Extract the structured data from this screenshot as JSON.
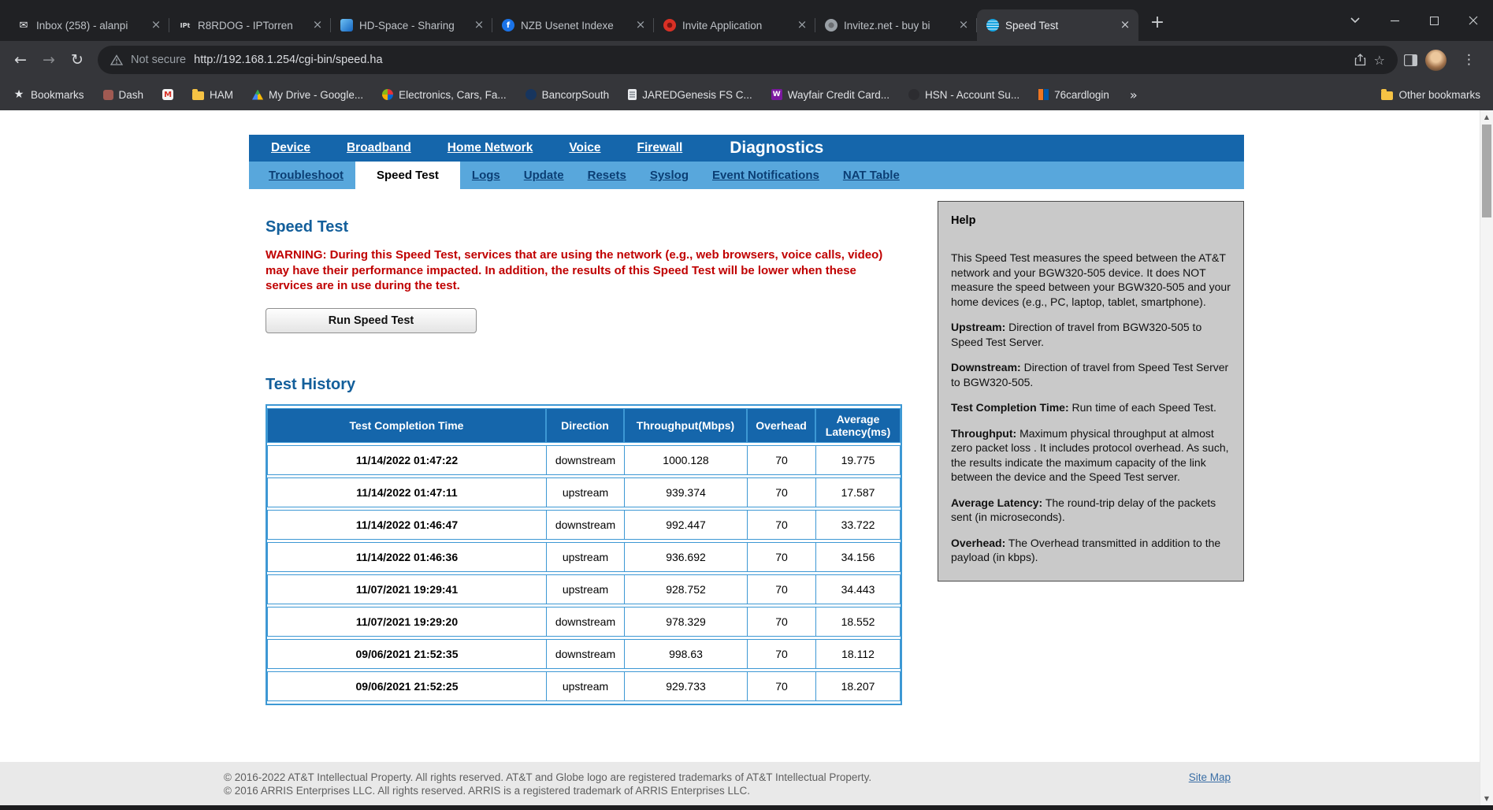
{
  "colors": {
    "nav_blue": "#1566ab",
    "subnav_blue": "#58a7dc",
    "heading_blue": "#135f9b",
    "warning_red": "#c00000",
    "table_border": "#3d98d4",
    "help_bg": "#c9c9c9",
    "link_blue": "#3a6ea5",
    "att_brand": "#00a8e0"
  },
  "browser": {
    "tabs": [
      {
        "title": "Inbox (258) - alanpi",
        "icon": "envelope",
        "glyph": "✉",
        "active": false
      },
      {
        "title": "R8RDOG - IPTorren",
        "icon": "ipt",
        "glyph": "IPt",
        "active": false
      },
      {
        "title": "HD-Space - Sharing",
        "icon": "hdspace",
        "glyph": "",
        "active": false
      },
      {
        "title": "NZB Usenet Indexe",
        "icon": "nzb",
        "glyph": "f",
        "active": false
      },
      {
        "title": "Invite Application",
        "icon": "invite",
        "glyph": "",
        "active": false
      },
      {
        "title": "Invitez.net - buy bi",
        "icon": "invitez",
        "glyph": "",
        "active": false
      },
      {
        "title": "Speed Test",
        "icon": "att-globe",
        "glyph": "",
        "active": true
      }
    ],
    "new_tab_glyph": "+",
    "address": {
      "security_label": "Not secure",
      "url": "http://192.168.1.254/cgi-bin/speed.ha"
    },
    "bookmarks": [
      {
        "label": "Bookmarks",
        "icon": "star",
        "glyph": "★"
      },
      {
        "label": "Dash",
        "icon": "dash",
        "glyph": ""
      },
      {
        "label": "",
        "icon": "gmail",
        "glyph": "M"
      },
      {
        "label": "HAM",
        "icon": "folder",
        "glyph": ""
      },
      {
        "label": "My Drive - Google...",
        "icon": "drive",
        "glyph": ""
      },
      {
        "label": "Electronics, Cars, Fa...",
        "icon": "ebay",
        "glyph": ""
      },
      {
        "label": "BancorpSouth",
        "icon": "bancorp",
        "glyph": ""
      },
      {
        "label": "JAREDGenesis FS C...",
        "icon": "doc",
        "glyph": ""
      },
      {
        "label": "Wayfair Credit Card...",
        "icon": "wayfair",
        "glyph": "W"
      },
      {
        "label": "HSN - Account Su...",
        "icon": "hsn",
        "glyph": ""
      },
      {
        "label": "76cardlogin",
        "icon": "bars76",
        "glyph": ""
      }
    ],
    "bookmarks_overflow": "»",
    "other_bookmarks": "Other bookmarks"
  },
  "page": {
    "nav": {
      "items": [
        "Device",
        "Broadband",
        "Home Network",
        "Voice",
        "Firewall"
      ],
      "active": "Diagnostics"
    },
    "subnav": {
      "items": [
        "Troubleshoot",
        "Speed Test",
        "Logs",
        "Update",
        "Resets",
        "Syslog",
        "Event Notifications",
        "NAT Table"
      ],
      "active": "Speed Test"
    },
    "main": {
      "title": "Speed Test",
      "warning": "WARNING: During this Speed Test, services that are using the network (e.g., web browsers, voice calls, video) may have their performance impacted. In addition, the results of this Speed Test will be lower when these services are in use during the test.",
      "run_button": "Run Speed Test",
      "history_title": "Test History",
      "table": {
        "headers": [
          "Test Completion Time",
          "Direction",
          "Throughput(Mbps)",
          "Overhead",
          "Average Latency(ms)"
        ],
        "rows": [
          [
            "11/14/2022 01:47:22",
            "downstream",
            "1000.128",
            "70",
            "19.775"
          ],
          [
            "11/14/2022 01:47:11",
            "upstream",
            "939.374",
            "70",
            "17.587"
          ],
          [
            "11/14/2022 01:46:47",
            "downstream",
            "992.447",
            "70",
            "33.722"
          ],
          [
            "11/14/2022 01:46:36",
            "upstream",
            "936.692",
            "70",
            "34.156"
          ],
          [
            "11/07/2021 19:29:41",
            "upstream",
            "928.752",
            "70",
            "34.443"
          ],
          [
            "11/07/2021 19:29:20",
            "downstream",
            "978.329",
            "70",
            "18.552"
          ],
          [
            "09/06/2021 21:52:35",
            "downstream",
            "998.63",
            "70",
            "18.112"
          ],
          [
            "09/06/2021 21:52:25",
            "upstream",
            "929.733",
            "70",
            "18.207"
          ]
        ]
      }
    },
    "help": {
      "title": "Help",
      "paragraphs": [
        {
          "bold": "",
          "text": "This Speed Test measures the speed between the AT&T network and your BGW320-505 device. It does NOT measure the speed between your BGW320-505 and your home devices (e.g., PC, laptop, tablet, smartphone)."
        },
        {
          "bold": "Upstream:",
          "text": " Direction of travel from BGW320-505 to Speed Test Server."
        },
        {
          "bold": "Downstream:",
          "text": " Direction of travel from Speed Test Server to BGW320-505."
        },
        {
          "bold": "Test Completion Time:",
          "text": " Run time of each Speed Test."
        },
        {
          "bold": "Throughput:",
          "text": " Maximum physical throughput at almost zero packet loss . It includes protocol overhead. As such, the results indicate the maximum capacity of the link between the device and the Speed Test server."
        },
        {
          "bold": "Average Latency:",
          "text": " The round-trip delay of the packets sent (in microseconds)."
        },
        {
          "bold": "Overhead:",
          "text": " The Overhead transmitted in addition to the payload (in kbps)."
        }
      ]
    },
    "footer": {
      "line1": "© 2016-2022 AT&T Intellectual Property. All rights reserved. AT&T and Globe logo are registered trademarks of AT&T Intellectual Property.",
      "line2": "© 2016 ARRIS Enterprises LLC. All rights reserved. ARRIS is a registered trademark of ARRIS Enterprises LLC.",
      "sitemap": "Site Map"
    }
  }
}
